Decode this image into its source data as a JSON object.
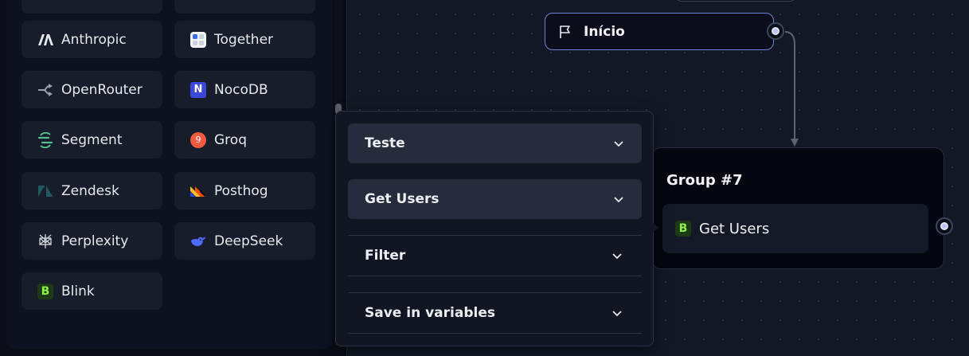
{
  "sidebar": {
    "blocks": [
      {
        "label": "Anthropic",
        "icon": "anthropic-icon"
      },
      {
        "label": "Together",
        "icon": "together-icon"
      },
      {
        "label": "OpenRouter",
        "icon": "openrouter-icon"
      },
      {
        "label": "NocoDB",
        "icon": "nocodb-icon"
      },
      {
        "label": "Segment",
        "icon": "segment-icon"
      },
      {
        "label": "Groq",
        "icon": "groq-icon"
      },
      {
        "label": "Zendesk",
        "icon": "zendesk-icon"
      },
      {
        "label": "Posthog",
        "icon": "posthog-icon"
      },
      {
        "label": "Perplexity",
        "icon": "perplexity-icon"
      },
      {
        "label": "DeepSeek",
        "icon": "deepseek-icon"
      },
      {
        "label": "Blink",
        "icon": "blink-icon"
      }
    ],
    "groq_badge": "9",
    "nocodb_badge": "N",
    "blink_badge": "B"
  },
  "canvas": {
    "start_node": {
      "label": "Início",
      "icon": "flag-icon"
    },
    "group_node": {
      "title": "Group #7",
      "block_label": "Get Users",
      "block_badge": "B"
    }
  },
  "popover": {
    "credential_select": "Teste",
    "action_select": "Get Users",
    "sections": [
      "Filter",
      "Save in variables"
    ]
  },
  "colors": {
    "canvas_bg": "#131826",
    "sidebar_bg": "#0e1220",
    "block_bg": "#181d2b",
    "start_border": "#6d84d6",
    "blink_green": "#8ef24a",
    "groq_orange": "#f05b3f",
    "nocodb_blue": "#3a47d8",
    "deepseek_blue": "#4d6bfe"
  }
}
